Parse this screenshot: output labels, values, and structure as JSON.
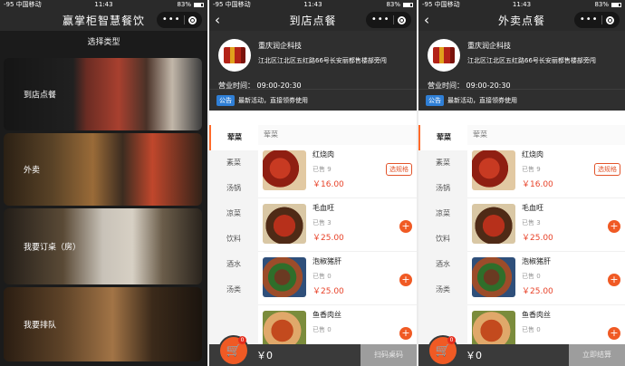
{
  "status": {
    "carrier": "-95 中国移动",
    "time": "11:43",
    "battery": "83%"
  },
  "screen1": {
    "title": "赢掌柜智慧餐饮",
    "subtitle": "选择类型",
    "options": [
      "到店点餐",
      "外卖",
      "我要订桌（房）",
      "我要排队"
    ]
  },
  "screen2": {
    "title": "到店点餐",
    "submit_label": "扫码桌码"
  },
  "screen3": {
    "title": "外卖点餐",
    "submit_label": "立即结算"
  },
  "shop": {
    "name": "重庆润企科技",
    "address": "江北区江北区五红路66号长安丽都售楼部旁闯",
    "hours": "营业时间：  09:00-20:30",
    "notice_tag": "公告",
    "notice_text": "最新活动，直接领券使用"
  },
  "categories": [
    "荤菜",
    "素菜",
    "汤锅",
    "凉菜",
    "饮料",
    "酒水",
    "汤类"
  ],
  "list_header": "荤菜",
  "items": [
    {
      "name": "红烧肉",
      "sold": "已售 9",
      "price": "￥16.00"
    },
    {
      "name": "毛血旺",
      "sold": "已售 3",
      "price": "￥25.00"
    },
    {
      "name": "泡椒猪肝",
      "sold": "已售 0",
      "price": "￥25.00"
    },
    {
      "name": "鱼香肉丝",
      "sold": "已售 0",
      "price": ""
    }
  ],
  "spec_label": "选规格",
  "add_symbol": "+",
  "cart": {
    "count": "0",
    "total": "￥0"
  },
  "icons": {
    "back": "chevron-left-icon",
    "more": "more-dots-icon",
    "home": "target-icon",
    "cart": "cart-icon"
  },
  "colors": {
    "accent": "#f05a24",
    "header": "#2a2a2a",
    "price": "#e8432a",
    "tag": "#2f7fd6"
  }
}
